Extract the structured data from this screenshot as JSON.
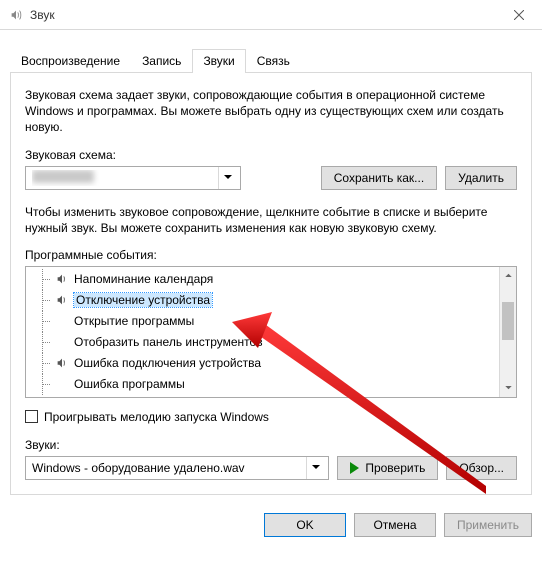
{
  "window": {
    "title": "Звук"
  },
  "tabs": {
    "playback": "Воспроизведение",
    "record": "Запись",
    "sounds": "Звуки",
    "comm": "Связь",
    "active": "Звуки"
  },
  "panel": {
    "scheme_desc": "Звуковая схема задает звуки, сопровождающие события в операционной системе Windows и программах. Вы можете выбрать одну из существующих схем или создать новую.",
    "scheme_label": "Звуковая схема:",
    "save_as": "Сохранить как...",
    "delete": "Удалить",
    "events_desc": "Чтобы изменить звуковое сопровождение, щелкните событие в списке и выберите нужный звук. Вы можете сохранить изменения как новую звуковую схему.",
    "events_label": "Программные события:",
    "events": [
      {
        "label": "Напоминание календаря",
        "has_sound": true
      },
      {
        "label": "Отключение устройства",
        "has_sound": true,
        "selected": true
      },
      {
        "label": "Открытие программы",
        "has_sound": false
      },
      {
        "label": "Отобразить панель инструментов",
        "has_sound": false
      },
      {
        "label": "Ошибка подключения устройства",
        "has_sound": true
      },
      {
        "label": "Ошибка программы",
        "has_sound": false
      }
    ],
    "startup_chk": "Проигрывать мелодию запуска Windows",
    "sounds_label": "Звуки:",
    "sound_file": "Windows - оборудование удалено.wav",
    "test": "Проверить",
    "browse": "Обзор..."
  },
  "buttons": {
    "ok": "OK",
    "cancel": "Отмена",
    "apply": "Применить"
  }
}
